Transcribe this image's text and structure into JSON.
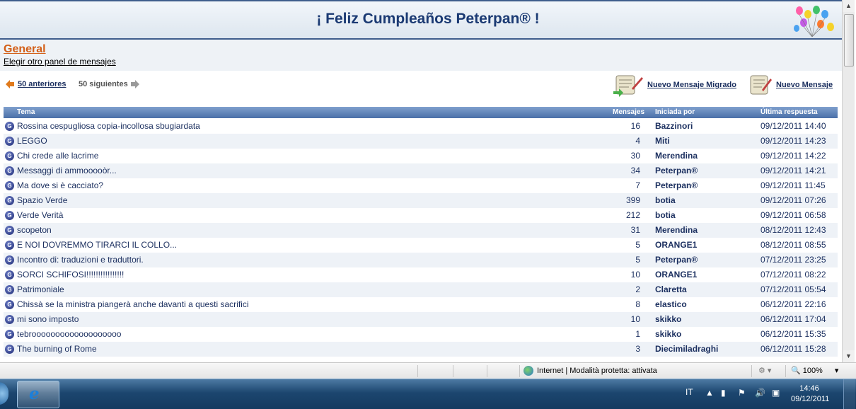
{
  "banner": {
    "title": "¡ Feliz Cumpleaños Peterpan® !"
  },
  "section": {
    "forum_name": "General",
    "choose_board": "Elegir otro panel de mensajes"
  },
  "pager": {
    "prev_label": "50 anteriores",
    "next_label": "50 siguientes"
  },
  "actions": {
    "new_migrated": "Nuevo Mensaje Migrado",
    "new_message": "Nuevo Mensaje"
  },
  "table": {
    "headers": {
      "topic": "Tema",
      "count": "Mensajes",
      "author": "Iniciada por",
      "last": "Última respuesta"
    },
    "rows": [
      {
        "topic": "Rossina cespugliosa copia-incollosa sbugiardata",
        "count": "16",
        "author": "Bazzinori",
        "last": "09/12/2011 14:40"
      },
      {
        "topic": "LEGGO",
        "count": "4",
        "author": "Miti",
        "last": "09/12/2011 14:23"
      },
      {
        "topic": "Chi crede alle lacrime",
        "count": "30",
        "author": "Merendina",
        "last": "09/12/2011 14:22"
      },
      {
        "topic": "Messaggi di ammooooòr...",
        "count": "34",
        "author": "Peterpan®",
        "last": "09/12/2011 14:21"
      },
      {
        "topic": "Ma dove si è cacciato?",
        "count": "7",
        "author": "Peterpan®",
        "last": "09/12/2011 11:45"
      },
      {
        "topic": "Spazio Verde",
        "count": "399",
        "author": "botia",
        "last": "09/12/2011 07:26"
      },
      {
        "topic": "Verde Verità",
        "count": "212",
        "author": "botia",
        "last": "09/12/2011 06:58"
      },
      {
        "topic": "scopeton",
        "count": "31",
        "author": "Merendina",
        "last": "08/12/2011 12:43"
      },
      {
        "topic": "E NOI DOVREMMO TIRARCI IL COLLO...",
        "count": "5",
        "author": "ORANGE1",
        "last": "08/12/2011 08:55"
      },
      {
        "topic": "Incontro di: traduzioni e traduttori.",
        "count": "5",
        "author": "Peterpan®",
        "last": "07/12/2011 23:25"
      },
      {
        "topic": "SORCI SCHIFOSI!!!!!!!!!!!!!!!!",
        "count": "10",
        "author": "ORANGE1",
        "last": "07/12/2011 08:22"
      },
      {
        "topic": "Patrimoniale",
        "count": "2",
        "author": "Claretta",
        "last": "07/12/2011 05:54"
      },
      {
        "topic": "Chissà se la ministra piangerà anche davanti a questi sacrifici",
        "count": "8",
        "author": "elastico",
        "last": "06/12/2011 22:16"
      },
      {
        "topic": "mi sono imposto",
        "count": "10",
        "author": "skikko",
        "last": "06/12/2011 17:04"
      },
      {
        "topic": "tebrooooooooooooooooooo",
        "count": "1",
        "author": "skikko",
        "last": "06/12/2011 15:35"
      },
      {
        "topic": "The burning of Rome",
        "count": "3",
        "author": "Diecimiladraghi",
        "last": "06/12/2011 15:28"
      }
    ]
  },
  "statusbar": {
    "zone": "Internet | Modalità protetta: attivata",
    "zoom": "100%"
  },
  "taskbar": {
    "language": "IT",
    "time": "14:46",
    "date": "09/12/2011"
  },
  "colors": {
    "accent_orange": "#d35e16",
    "header_blue": "#4a6fa8",
    "text_navy": "#1b2f5f"
  }
}
